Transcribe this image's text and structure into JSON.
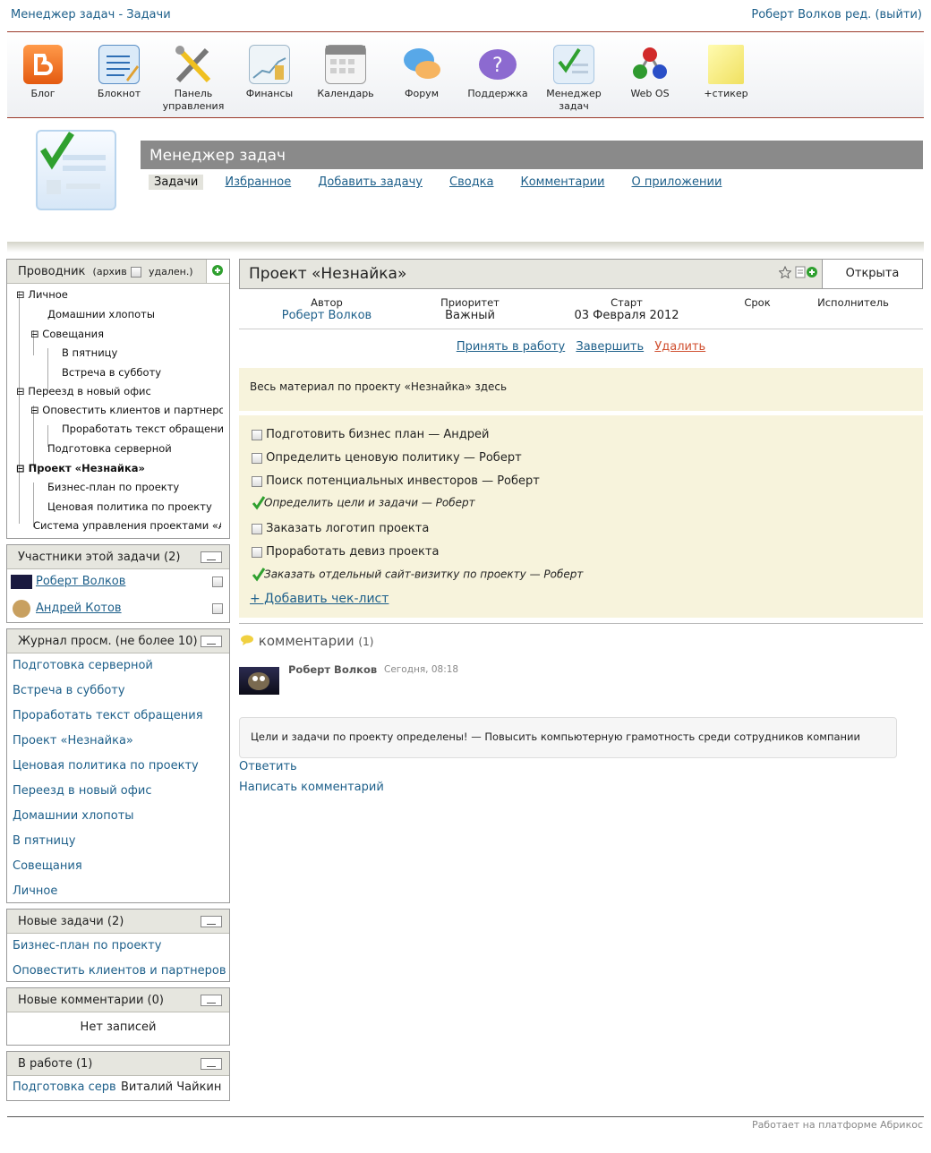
{
  "header": {
    "app_title": "Менеджер задач - Задачи",
    "user": "Роберт Волков",
    "edit": "ред.",
    "logout": "(выйти)"
  },
  "apps": [
    {
      "label": "Блог",
      "icon": "blog-icon"
    },
    {
      "label": "Блокнот",
      "icon": "notepad-icon"
    },
    {
      "label": "Панель управления",
      "icon": "control-panel-icon"
    },
    {
      "label": "Финансы",
      "icon": "finance-icon"
    },
    {
      "label": "Календарь",
      "icon": "calendar-icon"
    },
    {
      "label": "Форум",
      "icon": "forum-icon"
    },
    {
      "label": "Поддержка",
      "icon": "support-icon"
    },
    {
      "label": "Менеджер задач",
      "icon": "task-manager-icon"
    },
    {
      "label": "Web OS",
      "icon": "webos-icon"
    },
    {
      "label": "+стикер",
      "icon": "sticker-icon"
    }
  ],
  "page": {
    "title": "Менеджер задач",
    "nav": [
      "Задачи",
      "Избранное",
      "Добавить задачу",
      "Сводка",
      "Комментарии",
      "О приложении"
    ]
  },
  "explorer": {
    "title": "Проводник",
    "archive": "(архив",
    "deleted": "удален.)",
    "items": [
      "Личное",
      "Домашнии хлопоты",
      "Совещания",
      "В пятницу",
      "Встреча в субботу",
      "Переезд в новый офис",
      "Оповестить клиентов и партнеров",
      "Проработать текст обращения",
      "Подготовка серверной",
      "Проект «Незнайка»",
      "Бизнес-план по проекту",
      "Ценовая политика по проекту",
      "Система управления проектами «Абрикос»"
    ]
  },
  "participants": {
    "title": "Участники этой задачи",
    "count": "(2)",
    "users": [
      "Роберт Волков",
      "Андрей Котов"
    ]
  },
  "history": {
    "title": "Журнал просм.",
    "limit": "(не более 10)",
    "items": [
      "Подготовка серверной",
      "Встреча в субботу",
      "Проработать текст обращения",
      "Проект «Незнайка»",
      "Ценовая политика по проекту",
      "Переезд в новый офис",
      "Домашнии хлопоты",
      "В пятницу",
      "Совещания",
      "Личное"
    ]
  },
  "new_tasks": {
    "title": "Новые задачи",
    "count": "(2)",
    "items": [
      "Бизнес-план по проекту",
      "Оповестить клиентов и партнеров о переезде"
    ]
  },
  "new_comments": {
    "title": "Новые комментарии",
    "count": "(0)",
    "empty": "Нет записей"
  },
  "in_work": {
    "title": "В работе",
    "count": "(1)",
    "task": "Подготовка серверной",
    "person": "Виталий Чайкин"
  },
  "project": {
    "title": "Проект «Незнайка»",
    "status": "Открыта",
    "meta": {
      "author_label": "Автор",
      "author": "Роберт Волков",
      "priority_label": "Приоритет",
      "priority": "Важный",
      "start_label": "Старт",
      "start": "03 Февраля 2012",
      "deadline_label": "Срок",
      "assignee_label": "Исполнитель"
    },
    "actions": {
      "accept": "Принять в работу",
      "complete": "Завершить",
      "delete": "Удалить"
    },
    "description": "Весь материал по проекту «Незнайка» здесь",
    "checklist": [
      {
        "text": "Подготовить бизнес план — Андрей",
        "done": false
      },
      {
        "text": "Определить ценовую политику — Роберт",
        "done": false
      },
      {
        "text": "Поиск потенциальных инвесторов — Роберт",
        "done": false
      },
      {
        "text": "Определить цели и задачи — Роберт",
        "done": true
      },
      {
        "text": "Заказать логотип проекта",
        "done": false
      },
      {
        "text": "Проработать девиз проекта",
        "done": false
      },
      {
        "text": "Заказать отдельный сайт-визитку по проекту — Роберт",
        "done": true
      }
    ],
    "add_checklist": "+ Добавить чек-лист"
  },
  "comments": {
    "title": "комментарии",
    "count": "(1)",
    "author": "Роберт Волков",
    "time": "Сегодня, 08:18",
    "text": "Цели и задачи по проекту определены! — Повысить компьютерную грамотность среди сотрудников компании",
    "reply": "Ответить",
    "write": "Написать комментарий"
  },
  "footer": "Работает на платформе Абрикос"
}
